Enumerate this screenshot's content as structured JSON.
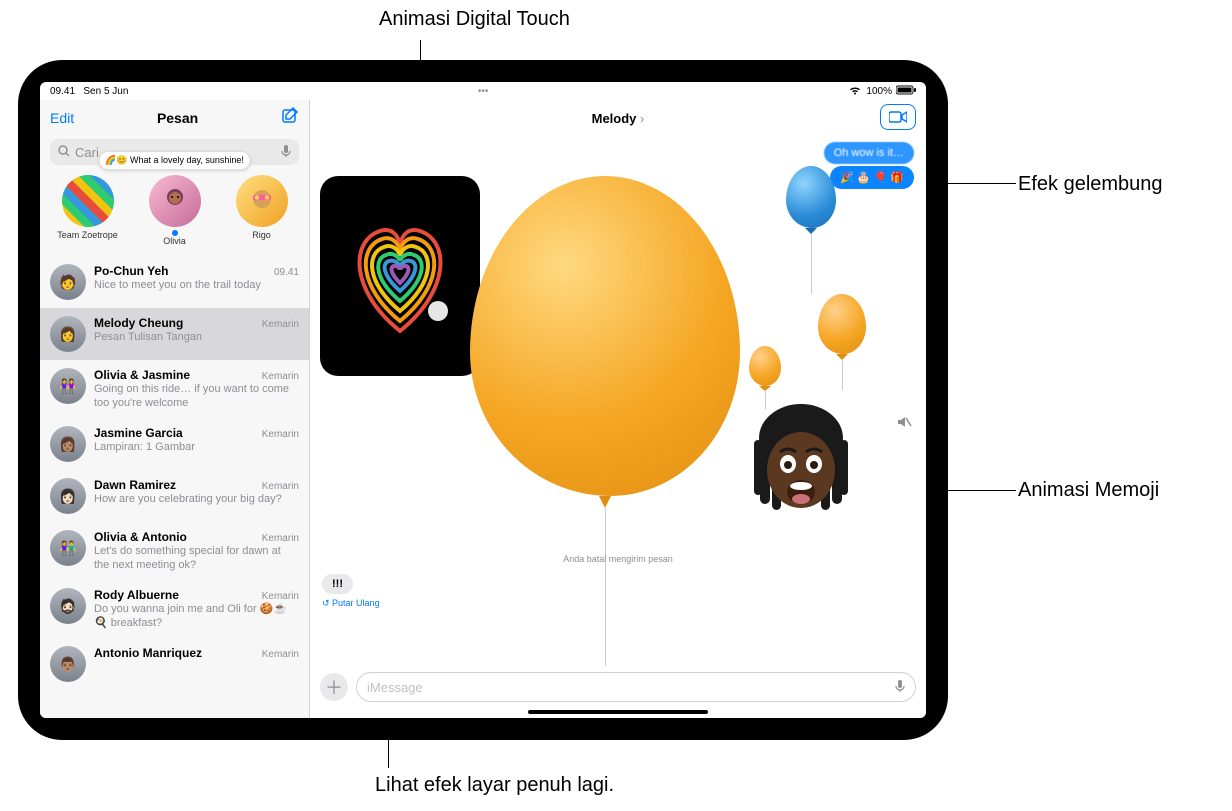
{
  "callouts": {
    "digital_touch": "Animasi Digital Touch",
    "bubble_effect": "Efek gelembung",
    "memoji": "Animasi Memoji",
    "fullscreen_replay": "Lihat efek layar penuh lagi."
  },
  "status": {
    "time": "09.41",
    "date": "Sen 5 Jun",
    "wifi": "wifi-icon",
    "battery_text": "100%"
  },
  "sidebar": {
    "edit": "Edit",
    "title": "Pesan",
    "compose_icon": "compose-icon",
    "search_placeholder": "Cari",
    "pinned": [
      {
        "label": "Team Zoetrope",
        "avatar": "stripes"
      },
      {
        "label": "Olivia",
        "avatar": "pink",
        "tooltip": "🌈😊 What a lovely day, sunshine!",
        "unread": true
      },
      {
        "label": "Rigo",
        "avatar": "yellow"
      }
    ],
    "conversations": [
      {
        "name": "Po-Chun Yeh",
        "time": "09.41",
        "preview": "Nice to meet you on the trail today"
      },
      {
        "name": "Melody Cheung",
        "time": "Kemarin",
        "preview": "Pesan Tulisan Tangan",
        "selected": true
      },
      {
        "name": "Olivia & Jasmine",
        "time": "Kemarin",
        "preview": "Going on this ride… if you want to come too you're welcome"
      },
      {
        "name": "Jasmine Garcia",
        "time": "Kemarin",
        "preview": "Lampiran: 1 Gambar"
      },
      {
        "name": "Dawn Ramirez",
        "time": "Kemarin",
        "preview": "How are you celebrating your big day?"
      },
      {
        "name": "Olivia & Antonio",
        "time": "Kemarin",
        "preview": "Let's do something special for dawn at the next meeting ok?"
      },
      {
        "name": "Rody Albuerne",
        "time": "Kemarin",
        "preview": "Do you wanna join me and Oli for 🍪☕🍳 breakfast?"
      },
      {
        "name": "Antonio Manriquez",
        "time": "Kemarin",
        "preview": ""
      }
    ]
  },
  "chat": {
    "title": "Melody",
    "video_icon": "video-icon",
    "outgoing": [
      "Oh wow is it…",
      "🎉 🎂 🎈 🎁"
    ],
    "undo_text": "Anda batal mengirim pesan",
    "small_bubble": "!!!",
    "replay": "↺ Putar Ulang",
    "mute_icon": "speaker-mute-icon",
    "input_placeholder": "iMessage",
    "plus_icon": "plus-icon"
  }
}
